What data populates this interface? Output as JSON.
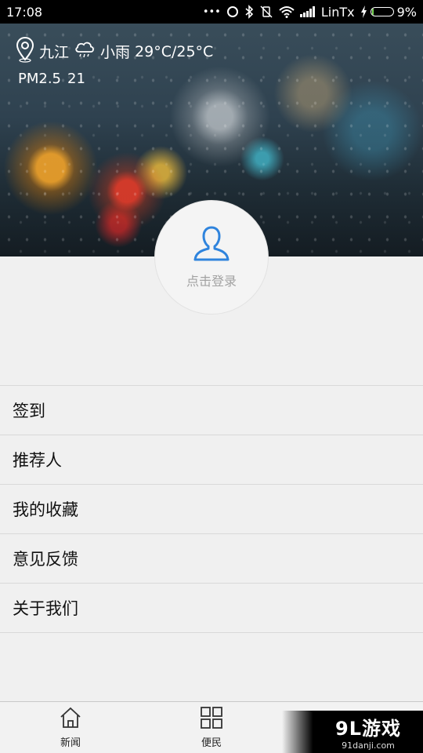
{
  "status_bar": {
    "time": "17:08",
    "dots": "•••",
    "carrier": "LinTx",
    "battery_percent": "9%",
    "battery_level": 0.09,
    "icons": [
      "sync-icon",
      "bluetooth-icon",
      "vibrate-off-icon",
      "wifi-icon",
      "signal-icon",
      "charging-icon",
      "battery-icon"
    ]
  },
  "weather": {
    "city": "九江",
    "condition": "小雨",
    "temperature": "29°C/25°C",
    "pm_label": "PM2.5",
    "pm_value": "21",
    "icons": [
      "location-pin-icon",
      "cloud-rain-icon"
    ]
  },
  "profile": {
    "login_label": "点击登录",
    "icon": "user-icon"
  },
  "menu": {
    "items": [
      {
        "label": "签到"
      },
      {
        "label": "推荐人"
      },
      {
        "label": "我的收藏"
      },
      {
        "label": "意见反馈"
      },
      {
        "label": "关于我们"
      }
    ]
  },
  "tabs": [
    {
      "label": "新闻",
      "icon": "home-icon"
    },
    {
      "label": "便民",
      "icon": "grid-icon"
    }
  ],
  "watermark": {
    "logo": "9L游戏",
    "url": "91danji.com"
  }
}
